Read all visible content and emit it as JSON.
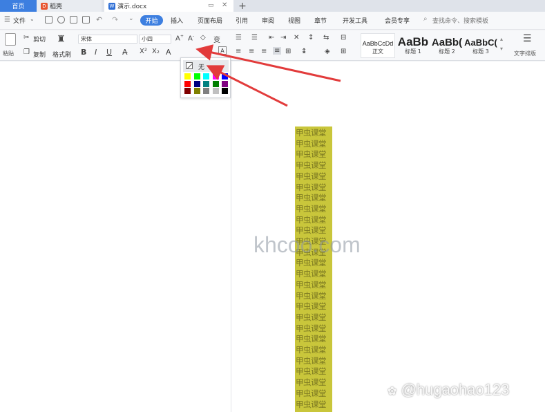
{
  "tabs": {
    "home": "首页",
    "daoke": "稻壳",
    "doc": "演示.docx"
  },
  "menu": {
    "file": "文件",
    "start": "开始",
    "insert": "插入",
    "layout": "页面布局",
    "references": "引用",
    "review": "审阅",
    "view": "视图",
    "section": "章节",
    "developer": "开发工具",
    "member": "会员专享",
    "search": "查找命令、搜索模板"
  },
  "ribbon": {
    "paste": "粘贴",
    "cut": "剪切",
    "copy": "复制",
    "format_painter": "格式刷",
    "font": "宋体",
    "size": "小四",
    "text_layout": "文字排版",
    "styles": [
      {
        "sample": "AaBbCcDd",
        "label": "正文"
      },
      {
        "sample": "AaBb",
        "label": "标题 1"
      },
      {
        "sample": "AaBb(",
        "label": "标题 2"
      },
      {
        "sample": "AaBbC(",
        "label": "标题 3"
      }
    ]
  },
  "highlight_menu": {
    "none": "无",
    "colors": [
      "#ffff00",
      "#00ff00",
      "#00ffff",
      "#ff00ff",
      "#0000ff",
      "#ff0000",
      "#000080",
      "#008080",
      "#008000",
      "#800080",
      "#800000",
      "#808000",
      "#808080",
      "#c0c0c0",
      "#000000"
    ]
  },
  "document": {
    "line_text": "甲虫课堂",
    "highlight_color": "#c9c63b"
  },
  "watermark": "khcoo.com",
  "credit": "@hugaohao123",
  "colors": {
    "accent": "#3d7fe0",
    "arrow": "#e23b3b"
  }
}
